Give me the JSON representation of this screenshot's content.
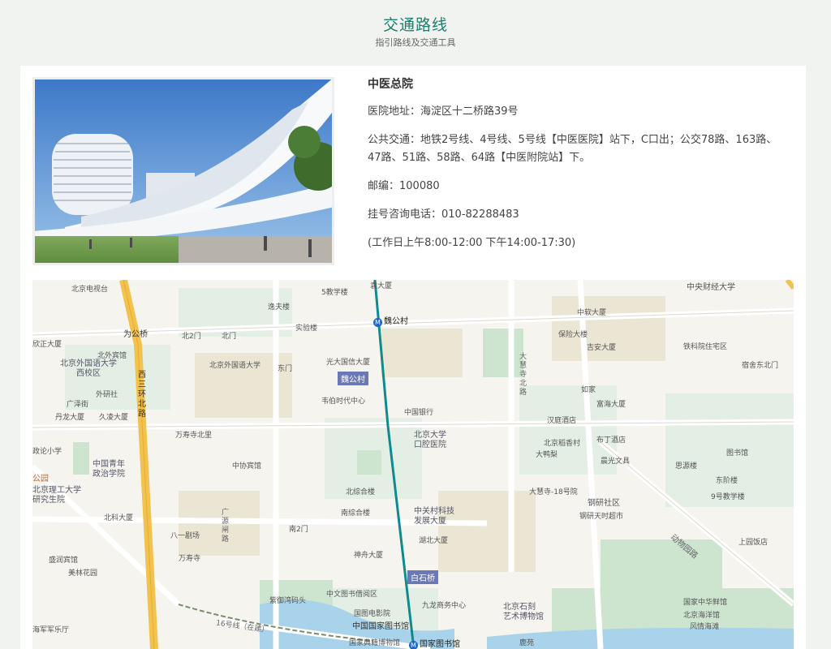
{
  "header": {
    "title": "交通路线",
    "subtitle": "指引路线及交通工具"
  },
  "hospital": {
    "name": "中医总院",
    "address": "医院地址：海淀区十二桥路39号",
    "transit": "公共交通：地铁2号线、4号线、5号线【中医医院】站下，C口出；公交78路、163路、47路、51路、58路、64路【中医附院站】下。",
    "postcode": "邮编：100080",
    "phone": "挂号咨询电话：010-82288483",
    "hours": "(工作日上午8:00-12:00 下午14:00-17:30)"
  },
  "map": {
    "labels": {
      "l1": "北京电视台",
      "l2": "逸夫楼",
      "l3": "5教学楼",
      "l4": "袁大厦",
      "l5": "魏公村",
      "l6": "实验楼",
      "l7": "中软大厦",
      "l8": "中央财经大学",
      "l9": "为公桥",
      "l10": "北2门",
      "l11": "北门",
      "l12": "保险大楼",
      "l13": "吉安大厦",
      "l14": "铁科院住宅区",
      "l15": "宿舍东北门",
      "l16": "欣正大厦",
      "l17": "北外宾馆",
      "l18": "北京外国语大学\n西校区",
      "l19": "北京外国语大学",
      "l20": "光大国信大厦",
      "l21": "东门",
      "l22": "大慧寺北路",
      "l23": "外研社",
      "l24": "广泽街",
      "l25": "丹龙大厦",
      "l26": "久凌大厦",
      "l27": "韦伯时代中心",
      "l28": "中国银行",
      "l29": "如家",
      "l30": "富海大厦",
      "l31": "汉庭酒店",
      "l32": "北京大学\n口腔医院",
      "l33": "万寿寺北里",
      "l34": "北京稻香村",
      "l35": "布丁酒店",
      "l36": "图书馆",
      "l37": "西三环北路",
      "l38": "政论小学",
      "l39": "中国青年\n政治学院",
      "l40": "中协宾馆",
      "l41": "大鸭梨",
      "l42": "晨光文具",
      "l43": "思源楼",
      "l44": "东阶楼",
      "l45": "北京理工大学\n研究生院",
      "l46": "北综合楼",
      "l47": "大慧寺-18号院",
      "l48": "钢研社区",
      "l49": "9号教学楼",
      "l50": "南综合楼",
      "l51": "中关村科技\n发展大厦",
      "l52": "钢研天时超市",
      "l53": "北科大厦",
      "l54": "广源闸路",
      "l55": "南2门",
      "l56": "八一剧场",
      "l57": "湖北大厦",
      "l58": "动物园路",
      "l59": "上园饭店",
      "l60": "盛润宾馆",
      "l61": "万寿寺",
      "l62": "神舟大厦",
      "l63": "美林花园",
      "l64": "紫御湾码头",
      "l65": "中文图书借阅区",
      "l66": "九龙商务中心",
      "l67": "国家中华鲜馆",
      "l68": "国图电影院",
      "l69": "中国国家图书馆",
      "l70": "北京石刻\n艺术博物馆",
      "l71": "北京海洋馆",
      "l72": "风情海滩",
      "l73": "16号线（在建）",
      "l74": "国家图书馆",
      "l75": "国家典籍博物馆",
      "l76": "鹿苑",
      "l77": "海军军乐厅",
      "l78": "北京理工大学",
      "l79": "公园"
    },
    "badges": {
      "b1": "魏公村",
      "b2": "白石桥"
    },
    "stations": {
      "s1": "魏公村",
      "s2": "国家图书馆"
    }
  },
  "colors": {
    "accent": "#1d7d6c",
    "metro": "#1a66c2",
    "line4": "#0f8a8e",
    "arterial": "#f2c24e"
  }
}
